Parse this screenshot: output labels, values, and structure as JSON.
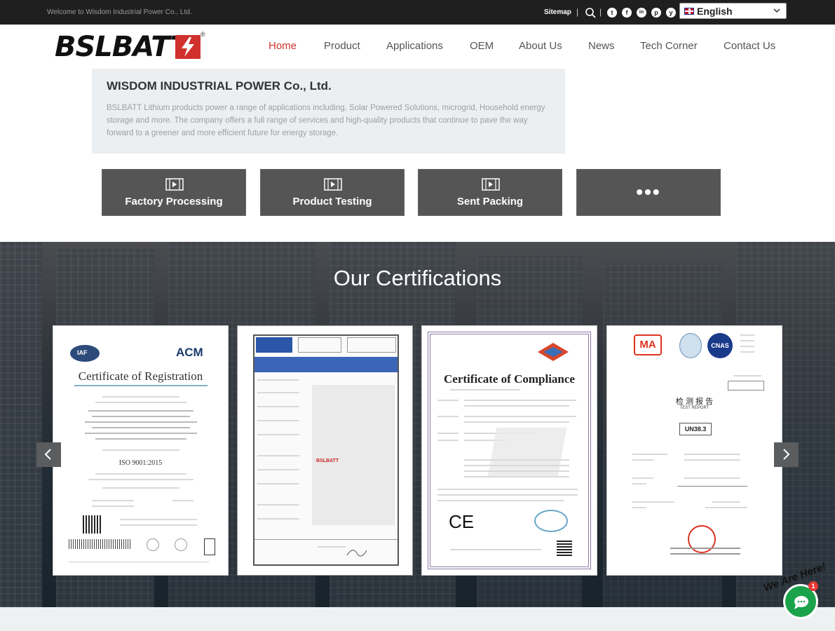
{
  "topbar": {
    "welcome": "Welcome to Wisdom Industrial Power Co., Ltd.",
    "sitemap": "Sitemap",
    "separator": "|",
    "social": [
      "t",
      "f",
      "in",
      "p",
      "y"
    ],
    "language": "English"
  },
  "logo": {
    "text": "BSLBATT",
    "reg": "®"
  },
  "nav": [
    "Home",
    "Product",
    "Applications",
    "OEM",
    "About Us",
    "News",
    "Tech Corner",
    "Contact Us"
  ],
  "intro": {
    "title": "WISDOM INDUSTRIAL POWER Co., Ltd.",
    "text": "BSLBATT Lithium products power a range of applications including, Solar Powered Solutions, microgrid, Household energy storage and more. The company offers a full range of services and high-quality products that continue to pave the way forward to a greener and more efficient future for energy storage."
  },
  "video_buttons": [
    {
      "label": "Factory Processing",
      "icon": "video-icon"
    },
    {
      "label": "Product Testing",
      "icon": "video-icon"
    },
    {
      "label": "Sent Packing",
      "icon": "video-icon"
    },
    {
      "label": "•••",
      "icon": "more-icon"
    }
  ],
  "certifications": {
    "heading": "Our Certifications",
    "cards": [
      {
        "title": "Certificate of Registration",
        "logo_left": "IAF",
        "logo_right": "ACM",
        "standard": "ISO 9001:2015"
      },
      {
        "title": "",
        "brand": "BSLBATT"
      },
      {
        "title": "Certificate of Compliance",
        "mark": "CE"
      },
      {
        "logo_left": "MA",
        "logo_right": "CNAS",
        "title": "检 测 报 告",
        "subtitle": "TEST REPORT",
        "code": "UN38.3"
      }
    ]
  },
  "chat": {
    "label": "We Are Here!",
    "badge": "1"
  },
  "colors": {
    "accent": "#d0312d",
    "topbar": "#1f1f1f",
    "button": "#555555",
    "chat": "#1aa34a"
  }
}
